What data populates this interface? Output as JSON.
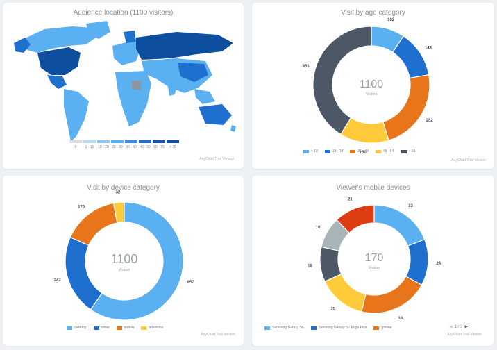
{
  "colors": {
    "c1": "#5ab0f0",
    "c2": "#1f6fcf",
    "c3": "#e8751a",
    "c4": "#ffcb3a",
    "c5": "#4c5866",
    "c6": "#a8b4b8",
    "c7": "#dd3d12"
  },
  "map": {
    "title": "Audience location (1100 visitors)",
    "scale_labels": [
      "0",
      "1 - 10",
      "10 - 20",
      "20 - 30",
      "30 - 40",
      "40 - 50",
      "50 - 75",
      "> 75"
    ],
    "credit": "AnyChart Trial Version"
  },
  "age": {
    "title": "Visit by age category",
    "center_value": "1100",
    "center_label": "Visitors",
    "credit": "AnyChart Trial Version"
  },
  "device": {
    "title": "Visit by device category",
    "center_value": "1100",
    "center_label": "Visitors",
    "credit": "AnyChart Trial Version"
  },
  "mobile": {
    "title": "Viewer's mobile devices",
    "center_value": "170",
    "center_label": "Visitors",
    "credit": "AnyChart Trial Version",
    "pager": "1 / 3"
  },
  "chart_data": [
    {
      "type": "pie",
      "title": "Visit by age category",
      "categories": [
        "< 18",
        "18 - 34",
        "35 - 44",
        "45 - 54",
        "> 55"
      ],
      "values": [
        102,
        143,
        252,
        150,
        453
      ],
      "labels": [
        "102",
        "143",
        "252",
        "150",
        "453"
      ],
      "colors": [
        "#5ab0f0",
        "#1f6fcf",
        "#e8751a",
        "#ffcb3a",
        "#4c5866"
      ]
    },
    {
      "type": "pie",
      "title": "Visit by device category",
      "categories": [
        "desktop",
        "tablet",
        "mobile",
        "television"
      ],
      "values": [
        657,
        242,
        170,
        32
      ],
      "labels": [
        "657",
        "242",
        "170",
        "32"
      ],
      "colors": [
        "#5ab0f0",
        "#1f6fcf",
        "#e8751a",
        "#ffcb3a"
      ]
    },
    {
      "type": "pie",
      "title": "Viewer's mobile devices",
      "categories": [
        "Samsung Galaxy S6",
        "Samsung Galaxy S7 Edge Plus",
        "Iphone",
        "",
        "",
        "",
        ""
      ],
      "values": [
        33,
        24,
        36,
        25,
        18,
        16,
        21
      ],
      "labels": [
        "33",
        "24",
        "36",
        "25",
        "18",
        "16",
        "21"
      ],
      "colors": [
        "#5ab0f0",
        "#1f6fcf",
        "#e8751a",
        "#ffcb3a",
        "#4c5866",
        "#a8b4b8",
        "#dd3d12"
      ]
    }
  ]
}
